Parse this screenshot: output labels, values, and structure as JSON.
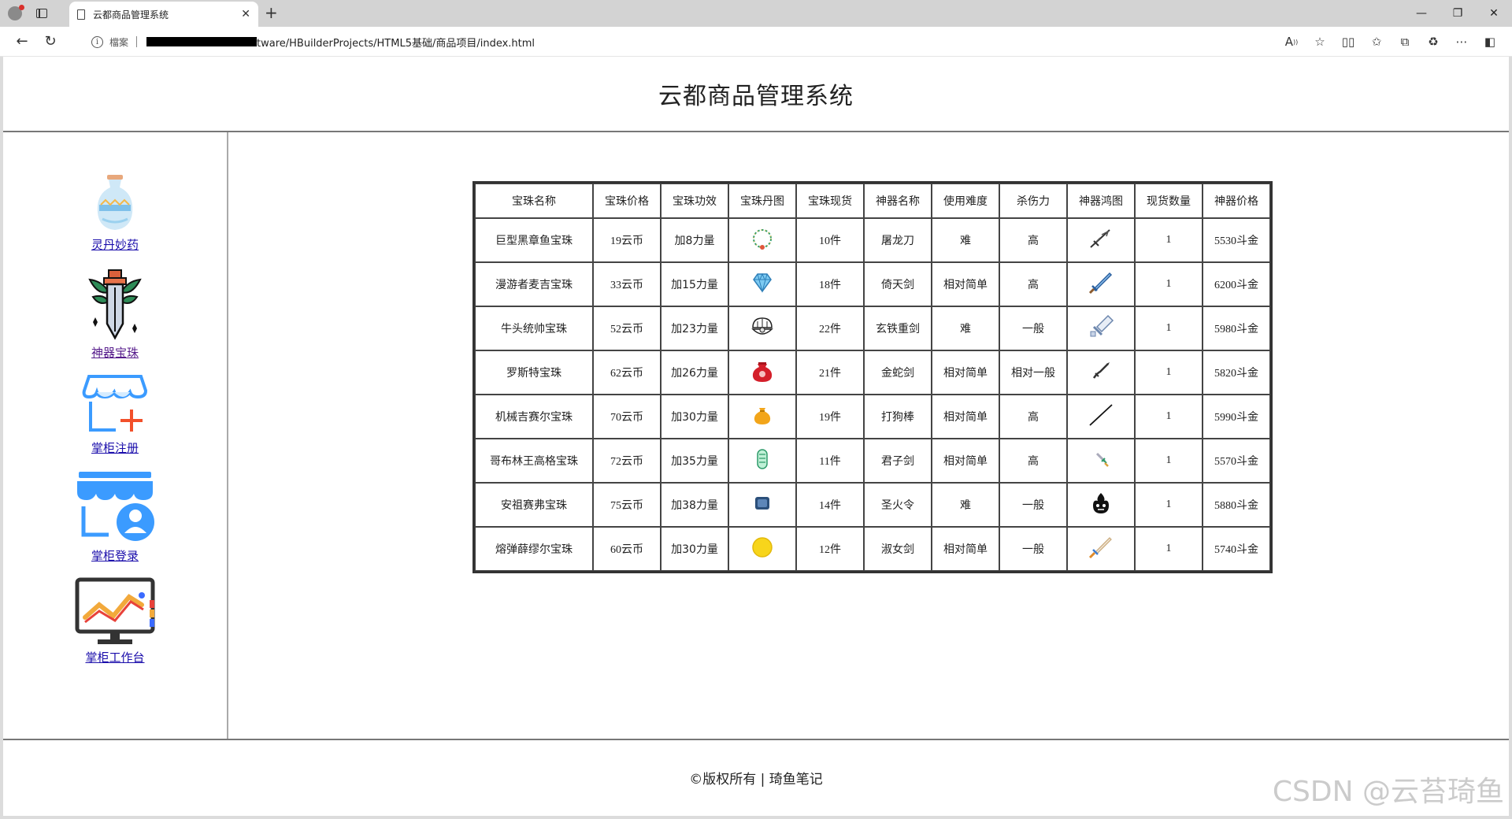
{
  "browser": {
    "tab_title": "云都商品管理系统",
    "file_label": "檔案",
    "url": "tware/HBuilderProjects/HTML5基础/商品项目/index.html"
  },
  "header": {
    "title": "云都商品管理系统"
  },
  "sidebar": {
    "items": [
      {
        "label": "灵丹妙药",
        "icon": "vase-icon"
      },
      {
        "label": "神器宝珠",
        "icon": "sword-icon"
      },
      {
        "label": "掌柜注册",
        "icon": "shop-add-icon"
      },
      {
        "label": "掌柜登录",
        "icon": "shop-user-icon"
      },
      {
        "label": "掌柜工作台",
        "icon": "monitor-chart-icon"
      }
    ]
  },
  "table": {
    "headers": [
      "宝珠名称",
      "宝珠价格",
      "宝珠功效",
      "宝珠丹图",
      "宝珠现货",
      "神器名称",
      "使用难度",
      "杀伤力",
      "神器鸿图",
      "现货数量",
      "神器价格"
    ],
    "rows": [
      {
        "name": "巨型黑章鱼宝珠",
        "price": "19云币",
        "effect": "加8力量",
        "gem_icon": "necklace-icon",
        "stock": "10件",
        "weapon": "屠龙刀",
        "difficulty": "难",
        "damage": "高",
        "weapon_icon": "dragon-blade-icon",
        "qty": "1",
        "weapon_price": "5530斗金"
      },
      {
        "name": "漫游者麦吉宝珠",
        "price": "33云币",
        "effect": "加15力量",
        "gem_icon": "diamond-icon",
        "stock": "18件",
        "weapon": "倚天剑",
        "difficulty": "相对简单",
        "damage": "高",
        "weapon_icon": "blue-sword-icon",
        "qty": "1",
        "weapon_price": "6200斗金"
      },
      {
        "name": "牛头统帅宝珠",
        "price": "52云币",
        "effect": "加23力量",
        "gem_icon": "pearl-shell-icon",
        "stock": "22件",
        "weapon": "玄铁重剑",
        "difficulty": "难",
        "damage": "一般",
        "weapon_icon": "heavy-sword-icon",
        "qty": "1",
        "weapon_price": "5980斗金"
      },
      {
        "name": "罗斯特宝珠",
        "price": "62云币",
        "effect": "加26力量",
        "gem_icon": "red-pouch-icon",
        "stock": "21件",
        "weapon": "金蛇剑",
        "difficulty": "相对简单",
        "damage": "相对一般",
        "weapon_icon": "snake-sword-icon",
        "qty": "1",
        "weapon_price": "5820斗金"
      },
      {
        "name": "机械吉赛尔宝珠",
        "price": "70云币",
        "effect": "加30力量",
        "gem_icon": "gold-pouch-icon",
        "stock": "19件",
        "weapon": "打狗棒",
        "difficulty": "相对简单",
        "damage": "高",
        "weapon_icon": "staff-icon",
        "qty": "1",
        "weapon_price": "5990斗金"
      },
      {
        "name": "哥布林王高格宝珠",
        "price": "72云币",
        "effect": "加35力量",
        "gem_icon": "jade-icon",
        "stock": "11件",
        "weapon": "君子剑",
        "difficulty": "相对简单",
        "damage": "高",
        "weapon_icon": "small-sword-icon",
        "qty": "1",
        "weapon_price": "5570斗金"
      },
      {
        "name": "安祖赛弗宝珠",
        "price": "75云币",
        "effect": "加38力量",
        "gem_icon": "blue-box-icon",
        "stock": "14件",
        "weapon": "圣火令",
        "difficulty": "难",
        "damage": "一般",
        "weapon_icon": "fire-token-icon",
        "qty": "1",
        "weapon_price": "5880斗金"
      },
      {
        "name": "熔弹薛缪尔宝珠",
        "price": "60云币",
        "effect": "加30力量",
        "gem_icon": "gold-coin-icon",
        "stock": "12件",
        "weapon": "淑女剑",
        "difficulty": "相对简单",
        "damage": "一般",
        "weapon_icon": "lady-sword-icon",
        "qty": "1",
        "weapon_price": "5740斗金"
      }
    ]
  },
  "footer": {
    "text": "©版权所有 | 琦鱼笔记"
  },
  "watermark": "CSDN @云苔琦鱼"
}
